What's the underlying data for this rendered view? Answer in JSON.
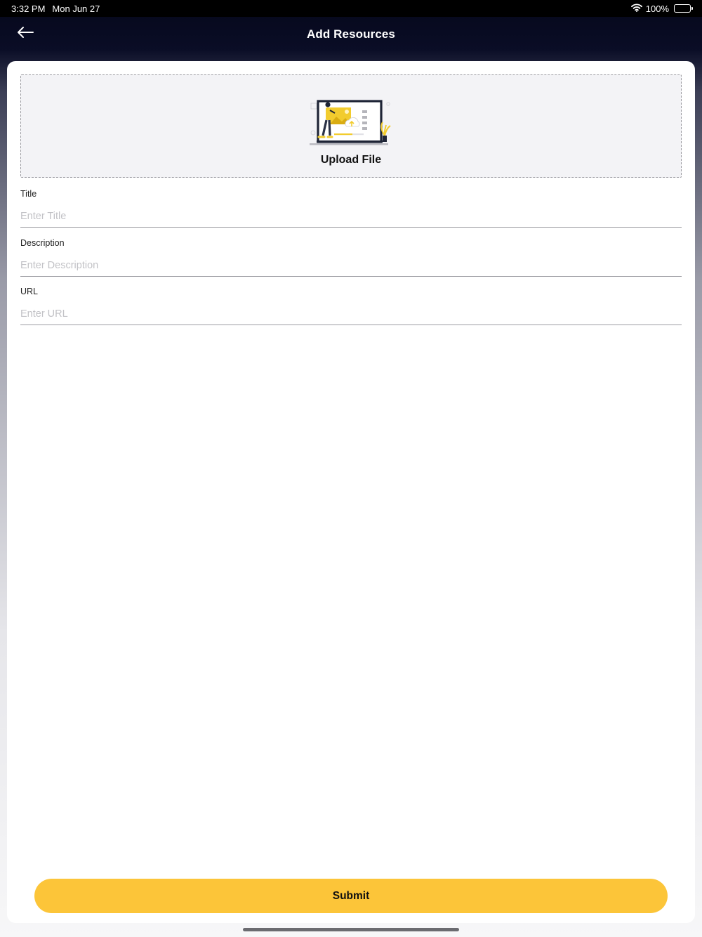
{
  "status_bar": {
    "time": "3:32 PM",
    "date": "Mon Jun 27",
    "battery_text": "100%",
    "icons": [
      "wifi-icon",
      "battery-icon"
    ]
  },
  "nav": {
    "title": "Add Resources",
    "back_icon": "arrow-left-icon"
  },
  "upload": {
    "label": "Upload File",
    "illustration": "upload-illustration"
  },
  "form": {
    "title": {
      "label": "Title",
      "value": "",
      "placeholder": "Enter Title"
    },
    "description": {
      "label": "Description",
      "value": "",
      "placeholder": "Enter Description"
    },
    "url": {
      "label": "URL",
      "value": "",
      "placeholder": "Enter URL"
    }
  },
  "submit_label": "Submit",
  "colors": {
    "accent": "#fcc539",
    "nav_background": "#05071a",
    "card_background": "#ffffff",
    "upload_background": "#f3f3f6"
  }
}
